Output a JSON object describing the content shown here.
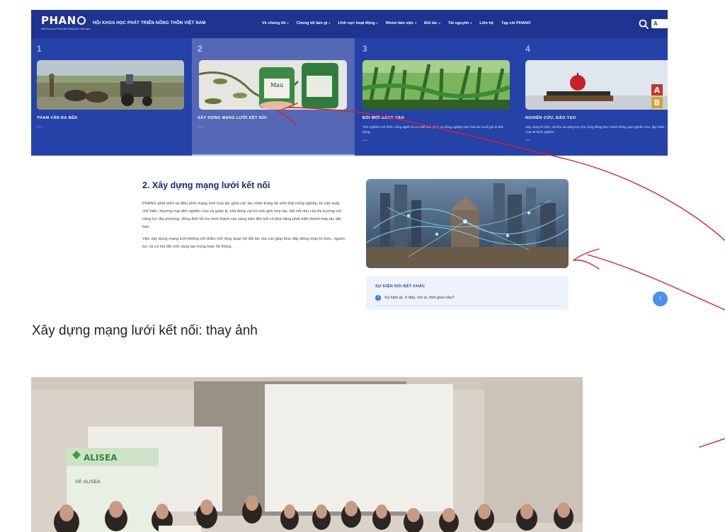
{
  "site": {
    "logo": {
      "word": "PHAN",
      "tagline": "Hội Khoa học Phát triển Nông thôn Việt Nam"
    },
    "org_name": "HỘI KHOA HỌC PHÁT TRIỂN NÔNG THÔN VIỆT NAM",
    "nav": [
      {
        "label": "Về chúng tôi",
        "caret": "▾"
      },
      {
        "label": "Chúng tôi làm gì",
        "caret": "▾"
      },
      {
        "label": "Lĩnh vực hoạt động",
        "caret": "▾"
      },
      {
        "label": "Nhóm làm việc",
        "caret": "▾"
      },
      {
        "label": "Đối tác",
        "caret": "▾"
      },
      {
        "label": "Tài nguyên",
        "caret": "▾"
      },
      {
        "label": "Liên hệ",
        "caret": ""
      },
      {
        "label": "Tạp chí PHANO",
        "caret": ""
      }
    ],
    "lang_badge": "A",
    "slides": [
      {
        "num": "1",
        "title": "THAM VẤN ĐA BÊN",
        "desc": "",
        "dots": "•••"
      },
      {
        "num": "2",
        "title": "XÂY DỰNG MẠNG LƯỚI KẾT NỐI",
        "desc": "",
        "dots": "•••",
        "bottle_label": "Mau"
      },
      {
        "num": "3",
        "title": "ĐỔI MỚI SÁNG TẠO",
        "desc": "Thử nghiệm mô hình, công nghệ và cơ chế mới phục vụ nông nghiệp sinh thái và chuỗi giá trị bền vững.",
        "dots": "•••"
      },
      {
        "num": "4",
        "title": "NGHIÊN CỨU, ĐÀO TẠO",
        "desc": "Xây dựng tri thức, tài liệu và năng lực cho cộng đồng thực hành thông qua nghiên cứu, tập huấn, chia sẻ kinh nghiệm.",
        "dots": "•••",
        "block_letters": [
          "A",
          "B"
        ]
      }
    ],
    "article": {
      "heading": "2. Xây dựng mạng lưới kết nối",
      "paragraphs": [
        "PHANO phát triển và điều phối mạng lưới hợp tác giữa các tác nhân trong hệ sinh thái nông nghiệp, từ sản xuất, chế biến, thương mại đến nghiên cứu và quản lý. Hội đóng vai trò môi giới hợp tác, kết nối nhu cầu thị trường với năng lực địa phương, đồng thời hỗ trợ hình thành các sáng kiến liên kết có khả năng phát triển thành hợp tác dài hạn.",
        "Việc xây dựng mạng lưới không chỉ nhằm mở rộng quan hệ đối tác mà còn giúp thúc đẩy dòng chảy tri thức, nguồn lực và cơ hội đổi mới sáng tạo trong toàn hệ thống."
      ]
    },
    "events": {
      "title": "SỰ KIỆN NỔI BẬT KHÁC",
      "item_num": "1",
      "item_text": "Sự kiện gì, ở đâu, với ai, thời gian nào?"
    },
    "back_to_top": "↑"
  },
  "caption": "Xây dựng mạng lưới kết nối: thay ảnh",
  "photo": {
    "poster_brand": "ALISEA",
    "poster_heading": "Về ALISEA"
  },
  "colors": {
    "nav_bg": "#1f3391",
    "slider_bg": "#2542a8",
    "active_slide": "#5468b6",
    "heading": "#1a2a73",
    "annotation": "#d8202a"
  }
}
